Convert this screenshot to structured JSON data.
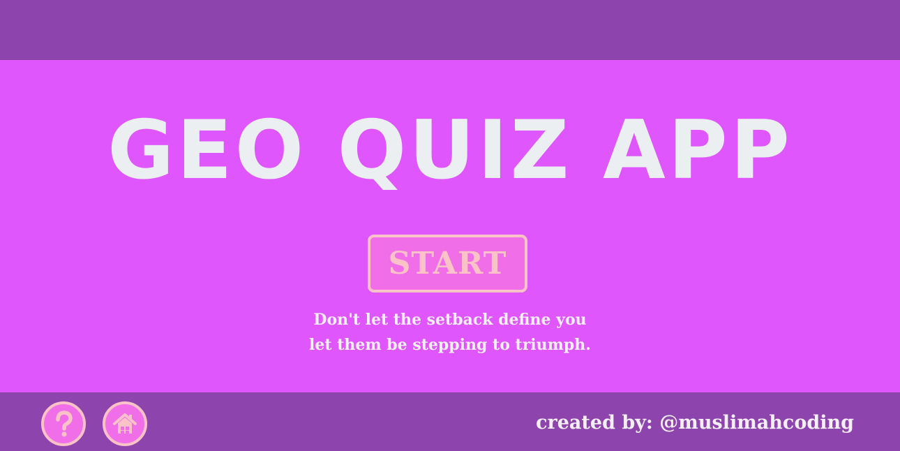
{
  "app": {
    "title": "GEO QUIZ APP"
  },
  "start_button": {
    "label": "START"
  },
  "quote": {
    "line1": "Don't let the setback define you",
    "line2": "let them be stepping to triumph."
  },
  "footer": {
    "help_icon": "question-circle-icon",
    "home_icon": "home-icon",
    "credit": "created by: @muslimahcoding"
  },
  "colors": {
    "header_footer": "#8e44ad",
    "main_background": "#df57fc",
    "button_fill": "#f06ee7",
    "button_accent": "#fbc2c8",
    "text_light": "#eceff1"
  }
}
